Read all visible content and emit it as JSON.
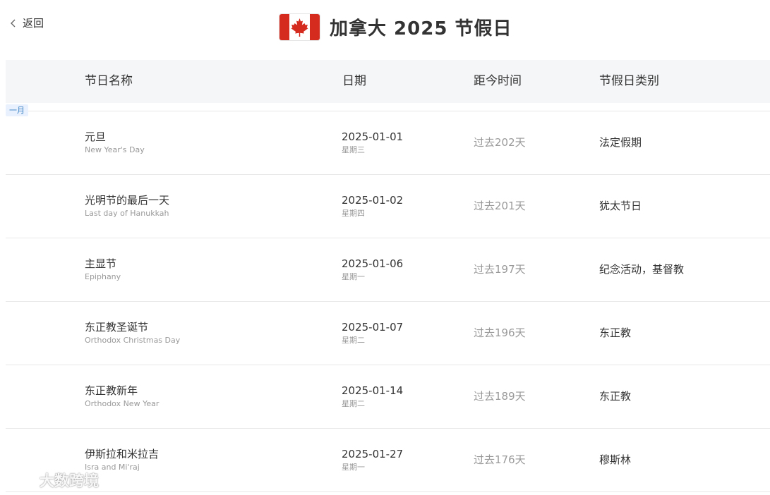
{
  "header": {
    "back_label": "返回",
    "title": "加拿大 2025 节假日"
  },
  "columns": {
    "name": "节日名称",
    "date": "日期",
    "since": "距今时间",
    "category": "节假日类别"
  },
  "month_label": "一月",
  "holidays": [
    {
      "name_cn": "元旦",
      "name_en": "New Year's Day",
      "date": "2025-01-01",
      "weekday": "星期三",
      "since": "过去202天",
      "category": "法定假期"
    },
    {
      "name_cn": "光明节的最后一天",
      "name_en": "Last day of Hanukkah",
      "date": "2025-01-02",
      "weekday": "星期四",
      "since": "过去201天",
      "category": "犹太节日"
    },
    {
      "name_cn": "主显节",
      "name_en": "Epiphany",
      "date": "2025-01-06",
      "weekday": "星期一",
      "since": "过去197天",
      "category": "纪念活动，基督教"
    },
    {
      "name_cn": "东正教圣诞节",
      "name_en": "Orthodox Christmas Day",
      "date": "2025-01-07",
      "weekday": "星期二",
      "since": "过去196天",
      "category": "东正教"
    },
    {
      "name_cn": "东正教新年",
      "name_en": "Orthodox New Year",
      "date": "2025-01-14",
      "weekday": "星期二",
      "since": "过去189天",
      "category": "东正教"
    },
    {
      "name_cn": "伊斯拉和米拉吉",
      "name_en": "Isra and Mi'raj",
      "date": "2025-01-27",
      "weekday": "星期一",
      "since": "过去176天",
      "category": "穆斯林"
    }
  ],
  "watermark": {
    "text": "大数跨境"
  },
  "icons": {
    "back": "chevron-left-icon",
    "flag": "canada-flag-icon",
    "watermark_logo": "brand-logo-icon"
  },
  "colors": {
    "flag_red": "#d52b1e",
    "month_badge_bg": "#e8f1fd",
    "month_badge_text": "#3b82c4",
    "header_bg": "#f5f6f8",
    "muted_text": "#999999"
  }
}
